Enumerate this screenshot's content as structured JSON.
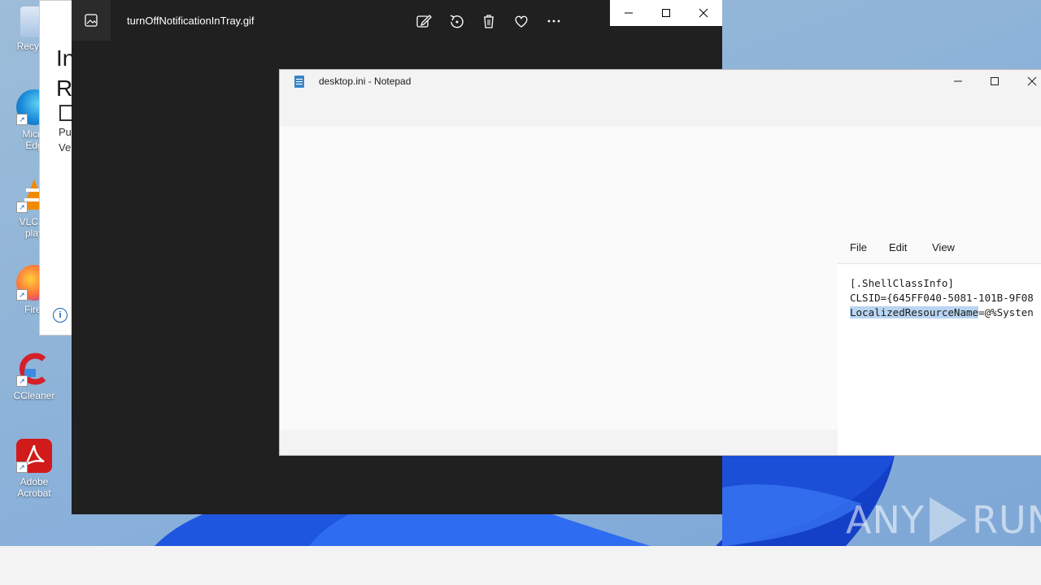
{
  "desktop": {
    "icons": [
      {
        "label": "Recycle",
        "icon": "recycle-bin-icon"
      },
      {
        "label": "Micro\nEdg",
        "icon": "edge-icon"
      },
      {
        "label": "VLC m\nplay",
        "icon": "vlc-icon"
      },
      {
        "label": "Firef",
        "icon": "firefox-icon"
      },
      {
        "label": "CCleaner",
        "icon": "ccleaner-icon"
      },
      {
        "label": "Adobe\nAcrobat",
        "icon": "acrobat-icon"
      }
    ]
  },
  "background_window": {
    "heading_1": "In",
    "heading_2": "R",
    "text_1": "Pu",
    "text_2": "Ve"
  },
  "photos": {
    "title": "turnOffNotificationInTray.gif",
    "toolbar": [
      "edit-icon",
      "rotate-icon",
      "delete-icon",
      "favorite-icon",
      "more-icon"
    ]
  },
  "notepad": {
    "title": "desktop.ini - Notepad",
    "menu": {
      "file": "File",
      "edit": "Edit",
      "view": "View"
    },
    "lines": {
      "line1": "[.ShellClassInfo]",
      "line2": "CLSID={645FF040-5081-101B-9F08",
      "line3_selected": "LocalizedResourceName",
      "line3_rest": "=@%Systen"
    }
  },
  "watermark": {
    "left": "ANY",
    "right": "RUN"
  },
  "colors": {
    "photos_bg": "#202020",
    "notepad_bg": "#f3f3f3",
    "selection": "#b9d5f2"
  }
}
